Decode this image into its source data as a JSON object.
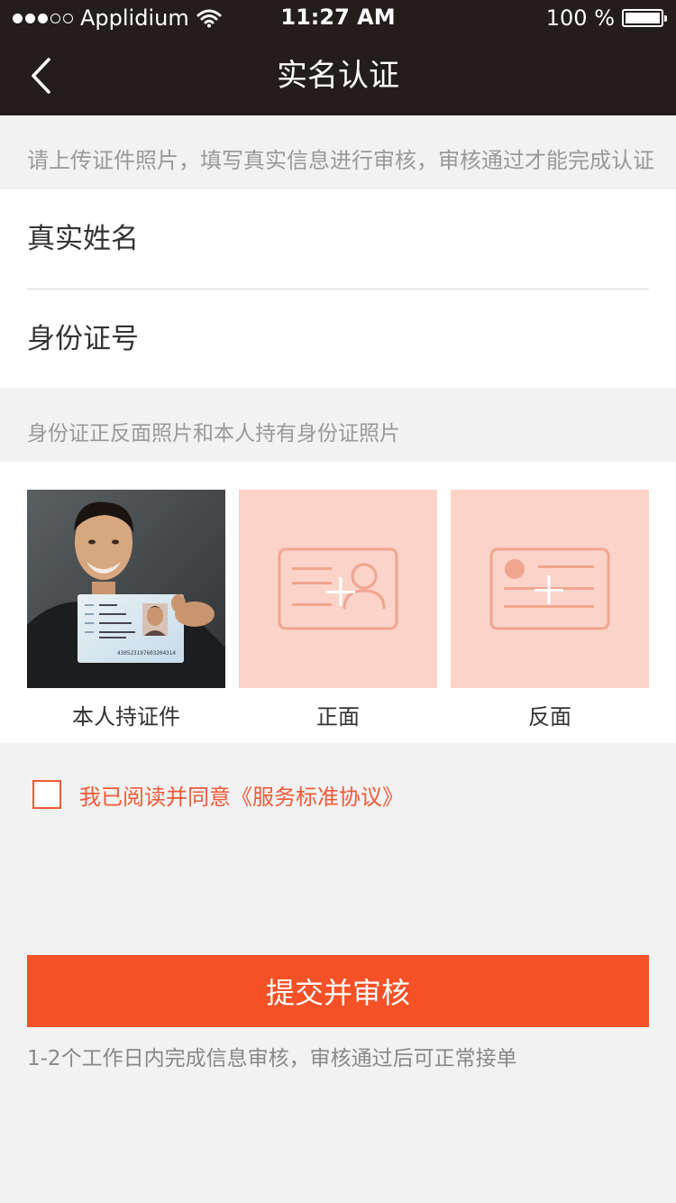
{
  "status_bar": {
    "carrier": "Applidium",
    "time": "11:27 AM",
    "battery": "100 %"
  },
  "nav": {
    "title": "实名认证",
    "back_icon": "chevron-left-icon"
  },
  "notice": "请上传证件照片，填写真实信息进行审核，审核通过才能完成认证",
  "form": {
    "name_placeholder": "真实姓名",
    "id_placeholder": "身份证号"
  },
  "photos": {
    "label": "身份证正反面照片和本人持有身份证照片",
    "items": [
      {
        "caption": "本人持证件"
      },
      {
        "caption": "正面"
      },
      {
        "caption": "反面"
      }
    ],
    "card_sample_number": "430523197603204314"
  },
  "agreement": {
    "prefix": "我已阅读并同意",
    "link": "《服务标准协议》"
  },
  "submit": {
    "label": "提交并审核",
    "note": "1-2个工作日内完成信息审核，审核通过后可正常接单"
  },
  "colors": {
    "header_bg": "#231e1c",
    "accent": "#f45127",
    "upload_bg": "#fbd3c9",
    "upload_stroke": "#f0a58e"
  }
}
